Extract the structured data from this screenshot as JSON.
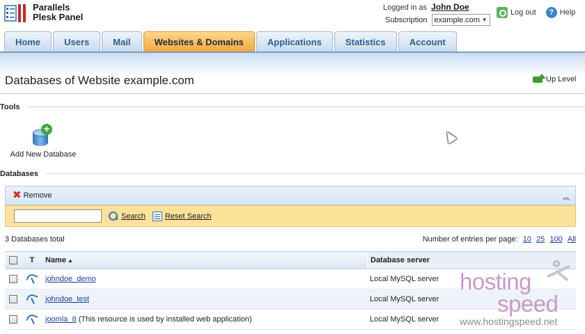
{
  "app": {
    "logo_line1": "Parallels",
    "logo_line2": "Plesk Panel",
    "logo_colors": {
      "red": "#c8282a",
      "blue": "#2f6aa8"
    }
  },
  "header": {
    "logged_in_label": "Logged in as",
    "user_name": "John Doe",
    "subscription_label": "Subscription",
    "subscription_value": "example.com",
    "logout_label": "Log out",
    "help_label": "Help"
  },
  "tabs": [
    {
      "label": "Home",
      "active": false
    },
    {
      "label": "Users",
      "active": false
    },
    {
      "label": "Mail",
      "active": false
    },
    {
      "label": "Websites & Domains",
      "active": true
    },
    {
      "label": "Applications",
      "active": false
    },
    {
      "label": "Statistics",
      "active": false
    },
    {
      "label": "Account",
      "active": false
    }
  ],
  "page": {
    "title": "Databases of Website example.com",
    "up_level_label": "Up Level"
  },
  "tools": {
    "section_title": "Tools",
    "items": [
      {
        "label": "Add New Database",
        "icon": "add-database-icon"
      }
    ]
  },
  "databases": {
    "section_title": "Databases",
    "remove_label": "Remove",
    "search": {
      "value": "",
      "search_label": "Search",
      "reset_label": "Reset Search"
    },
    "total_text": "3 Databases total",
    "per_page_label": "Number of entries per page:",
    "per_page_options": [
      "10",
      "25",
      "100",
      "All"
    ],
    "columns": {
      "check": "",
      "type": "T",
      "name": "Name",
      "server": "Database server"
    },
    "rows": [
      {
        "name": "johndoe_demo",
        "note": "",
        "server": "Local MySQL server"
      },
      {
        "name": "johndoe_test",
        "note": "",
        "server": "Local MySQL server"
      },
      {
        "name": "joomla_8",
        "note": "(This resource is used by installed web application)",
        "server": "Local MySQL server"
      }
    ]
  },
  "watermark": {
    "line1": "hosting",
    "line2": "speed",
    "url": "www.hostingspeed.net"
  },
  "colors": {
    "active_tab": "#f2a53d",
    "tab_text": "#2b5f8f",
    "search_bar": "#fde39a",
    "link": "#1a3f9a"
  }
}
